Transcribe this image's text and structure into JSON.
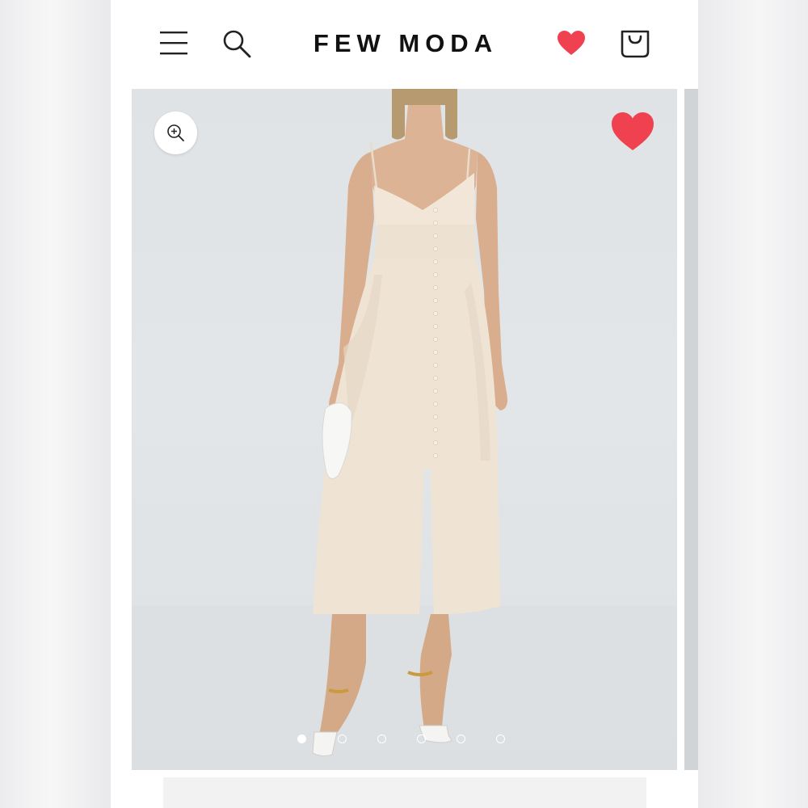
{
  "header": {
    "brand": "FEW MODA",
    "menu_icon": "hamburger-menu-icon",
    "search_icon": "search-icon",
    "wishlist_icon": "heart-icon",
    "bag_icon": "shopping-bag-icon"
  },
  "gallery": {
    "zoom_icon": "zoom-in-icon",
    "favorite_icon": "heart-icon",
    "slide_count": 6,
    "active_slide": 1
  },
  "colors": {
    "heart": "#ef4150",
    "photo_background": "#e0e4e6",
    "dress": "#efe3d4",
    "text": "#111111"
  }
}
